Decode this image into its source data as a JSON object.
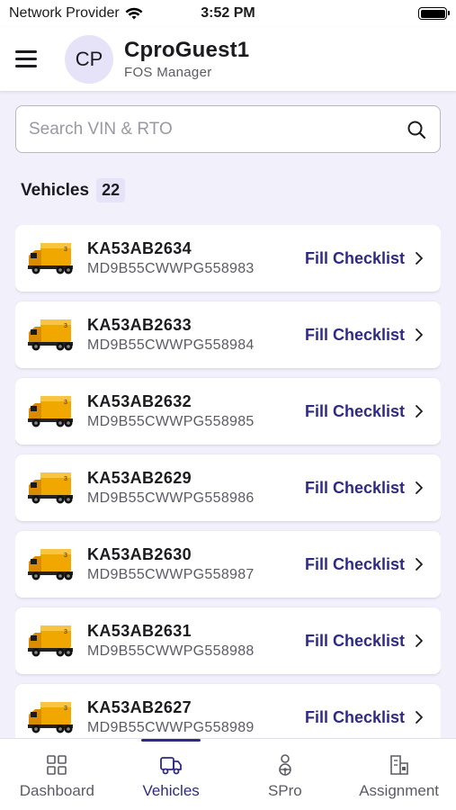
{
  "status_bar": {
    "carrier": "Network Provider",
    "time": "3:52 PM"
  },
  "header": {
    "avatar_initials": "CP",
    "user_name": "CproGuest1",
    "user_role": "FOS Manager"
  },
  "search": {
    "placeholder": "Search VIN & RTO",
    "value": ""
  },
  "section": {
    "title": "Vehicles",
    "count": "22"
  },
  "vehicles": [
    {
      "reg": "KA53AB2634",
      "vin": "MD9B55CWWPG558983",
      "action": "Fill Checklist"
    },
    {
      "reg": "KA53AB2633",
      "vin": "MD9B55CWWPG558984",
      "action": "Fill Checklist"
    },
    {
      "reg": "KA53AB2632",
      "vin": "MD9B55CWWPG558985",
      "action": "Fill Checklist"
    },
    {
      "reg": "KA53AB2629",
      "vin": "MD9B55CWWPG558986",
      "action": "Fill Checklist"
    },
    {
      "reg": "KA53AB2630",
      "vin": "MD9B55CWWPG558987",
      "action": "Fill Checklist"
    },
    {
      "reg": "KA53AB2631",
      "vin": "MD9B55CWWPG558988",
      "action": "Fill Checklist"
    },
    {
      "reg": "KA53AB2627",
      "vin": "MD9B55CWWPG558989",
      "action": "Fill Checklist"
    }
  ],
  "bottom_nav": [
    {
      "label": "Dashboard",
      "icon": "dashboard-icon",
      "active": false
    },
    {
      "label": "Vehicles",
      "icon": "vehicle-icon",
      "active": true
    },
    {
      "label": "SPro",
      "icon": "spro-icon",
      "active": false
    },
    {
      "label": "Assignment",
      "icon": "assignment-icon",
      "active": false
    }
  ],
  "colors": {
    "accent": "#2e2a86",
    "background": "#f1f0fb",
    "avatar_bg": "#e6e3f8",
    "truck": "#f0a800"
  }
}
